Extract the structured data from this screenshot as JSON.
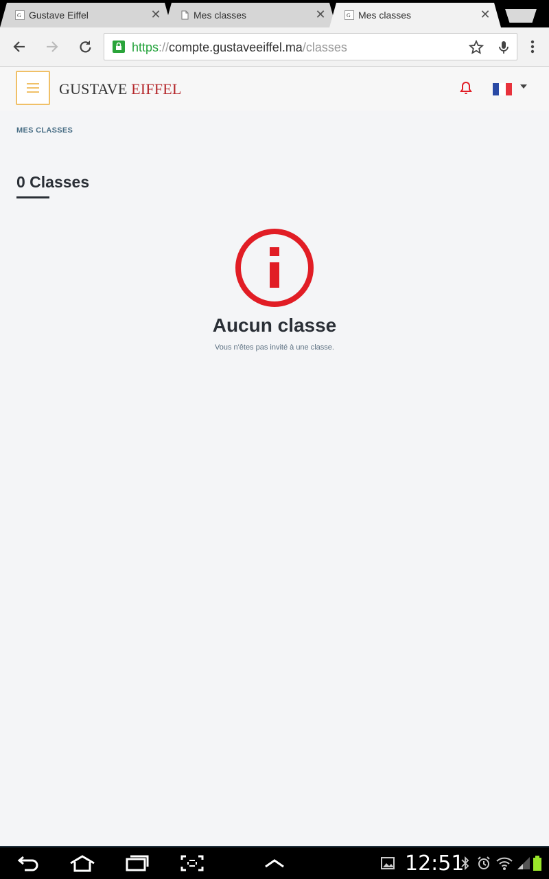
{
  "browser": {
    "tabs": [
      {
        "title": "Gustave Eiffel",
        "active": false
      },
      {
        "title": "Mes classes",
        "active": false
      },
      {
        "title": "Mes classes",
        "active": true
      }
    ],
    "close_glyph": "✕",
    "url": {
      "scheme": "https",
      "separator": "://",
      "host": "compte.gustaveeiffel.ma",
      "path": "/classes"
    }
  },
  "site": {
    "logo": {
      "word1": "GUSTAVE",
      "word2": "EIFFEL"
    },
    "colors": {
      "accent_red": "#e11d25",
      "logo_red": "#b4262a",
      "menu_border": "#f0c067",
      "flag_blue": "#2a4aa5",
      "flag_red": "#e8323c"
    }
  },
  "breadcrumb": "MES CLASSES",
  "page_title": "0 Classes",
  "empty_state": {
    "icon": "info-circle-icon",
    "title": "Aucun classe",
    "subtitle": "Vous n'êtes pas invité à une classe."
  },
  "system_bar": {
    "time": "12:51",
    "battery_color": "#9ae62a"
  }
}
